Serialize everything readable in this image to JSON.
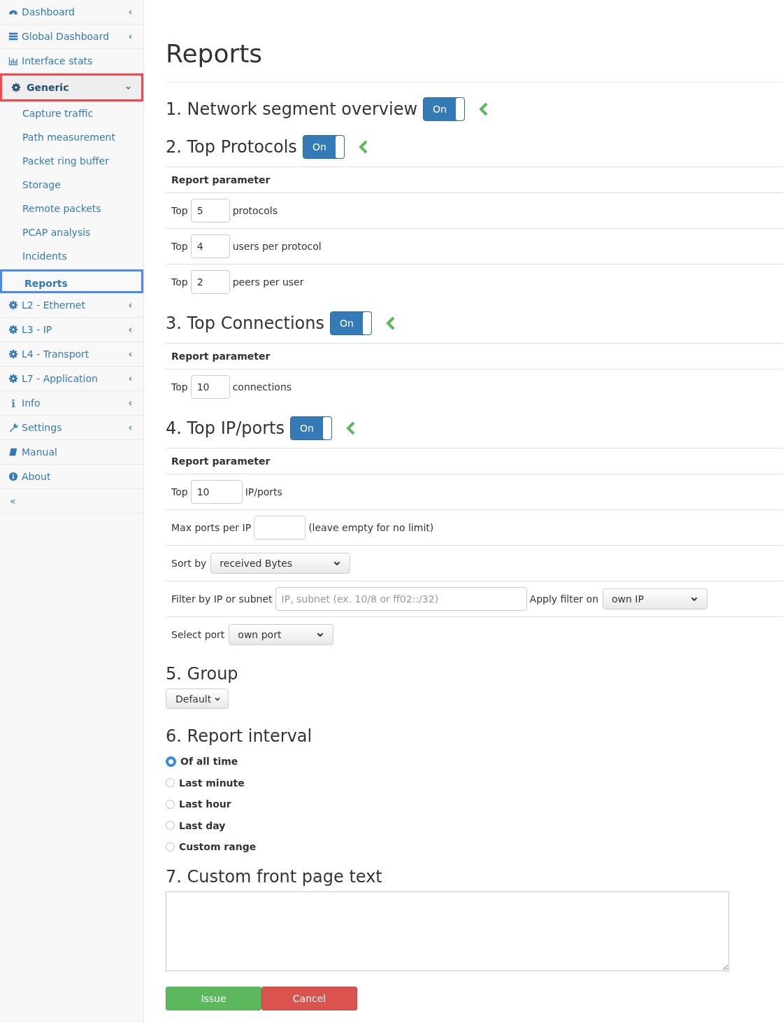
{
  "sidebar": {
    "items": [
      {
        "label": "Dashboard",
        "selected": false,
        "expanded": false
      },
      {
        "label": "Global Dashboard",
        "selected": false,
        "expanded": false
      },
      {
        "label": "Interface stats",
        "selected": false
      },
      {
        "label": "Generic",
        "selected": true,
        "expanded": true,
        "children": [
          {
            "label": "Capture traffic",
            "selected": false
          },
          {
            "label": "Path measurement",
            "selected": false
          },
          {
            "label": "Packet ring buffer",
            "selected": false
          },
          {
            "label": "Storage",
            "selected": false
          },
          {
            "label": "Remote packets",
            "selected": false
          },
          {
            "label": "PCAP analysis",
            "selected": false
          },
          {
            "label": "Incidents",
            "selected": false
          },
          {
            "label": "Reports",
            "selected": true
          }
        ]
      },
      {
        "label": "L2 - Ethernet",
        "selected": false,
        "expanded": false
      },
      {
        "label": "L3 - IP",
        "selected": false,
        "expanded": false
      },
      {
        "label": "L4 - Transport",
        "selected": false,
        "expanded": false
      },
      {
        "label": "L7 - Application",
        "selected": false,
        "expanded": false
      },
      {
        "label": "Info",
        "selected": false,
        "expanded": false
      },
      {
        "label": "Settings",
        "selected": false,
        "expanded": false
      },
      {
        "label": "Manual",
        "selected": false
      },
      {
        "label": "About",
        "selected": false
      }
    ],
    "collapse_label": "«"
  },
  "page": {
    "title": "Reports",
    "sections": [
      {
        "kind": "toggle",
        "title": "1. Network segment overview",
        "toggle": {
          "label": "On",
          "on": true
        }
      },
      {
        "kind": "toggle",
        "title": "2. Top Protocols",
        "toggle": {
          "label": "On",
          "on": true
        },
        "params_header": "Report parameter",
        "params": [
          {
            "kind": "number",
            "label": "Top",
            "value": "5",
            "suffix": "protocols"
          },
          {
            "kind": "number",
            "label": "Top",
            "value": "4",
            "suffix": "users per protocol"
          },
          {
            "kind": "number",
            "label": "Top",
            "value": "2",
            "suffix": "peers per user"
          }
        ]
      },
      {
        "kind": "toggle",
        "title": "3. Top Connections",
        "toggle": {
          "label": "On",
          "on": true
        },
        "params_header": "Report parameter",
        "params": [
          {
            "kind": "number",
            "label": "Top",
            "value": "10",
            "suffix": "connections"
          }
        ]
      },
      {
        "kind": "toggle",
        "title": "4. Top IP/ports",
        "toggle": {
          "label": "On",
          "on": true
        },
        "params_header": "Report parameter",
        "params": [
          {
            "kind": "number-wide",
            "label": "Top",
            "value": "10",
            "suffix": "IP/ports"
          },
          {
            "kind": "number-wide",
            "label": "Max ports per IP",
            "suffix": "(leave empty for no limit)"
          },
          {
            "kind": "select",
            "label": "Sort by",
            "value": "received Bytes"
          },
          {
            "kind": "filter",
            "label": "Filter by IP or subnet",
            "placeholder": "IP, subnet (ex. 10/8 or ff02::/32)",
            "label2": "Apply filter on",
            "value": "own IP"
          },
          {
            "kind": "select-small",
            "label": "Select port",
            "value": "own port"
          }
        ]
      },
      {
        "kind": "group",
        "title": "5. Group",
        "value": "Default"
      },
      {
        "kind": "radios",
        "title": "6. Report interval",
        "options": [
          {
            "label": "Of all time",
            "selected": true
          },
          {
            "label": "Last minute",
            "selected": false
          },
          {
            "label": "Last hour",
            "selected": false
          },
          {
            "label": "Last day",
            "selected": false
          },
          {
            "label": "Custom range",
            "selected": false
          }
        ]
      },
      {
        "kind": "textarea",
        "title": "7. Custom front page text"
      }
    ],
    "buttons": [
      {
        "label": "Issue",
        "kind": "success"
      },
      {
        "label": "Cancel",
        "kind": "danger"
      }
    ]
  }
}
